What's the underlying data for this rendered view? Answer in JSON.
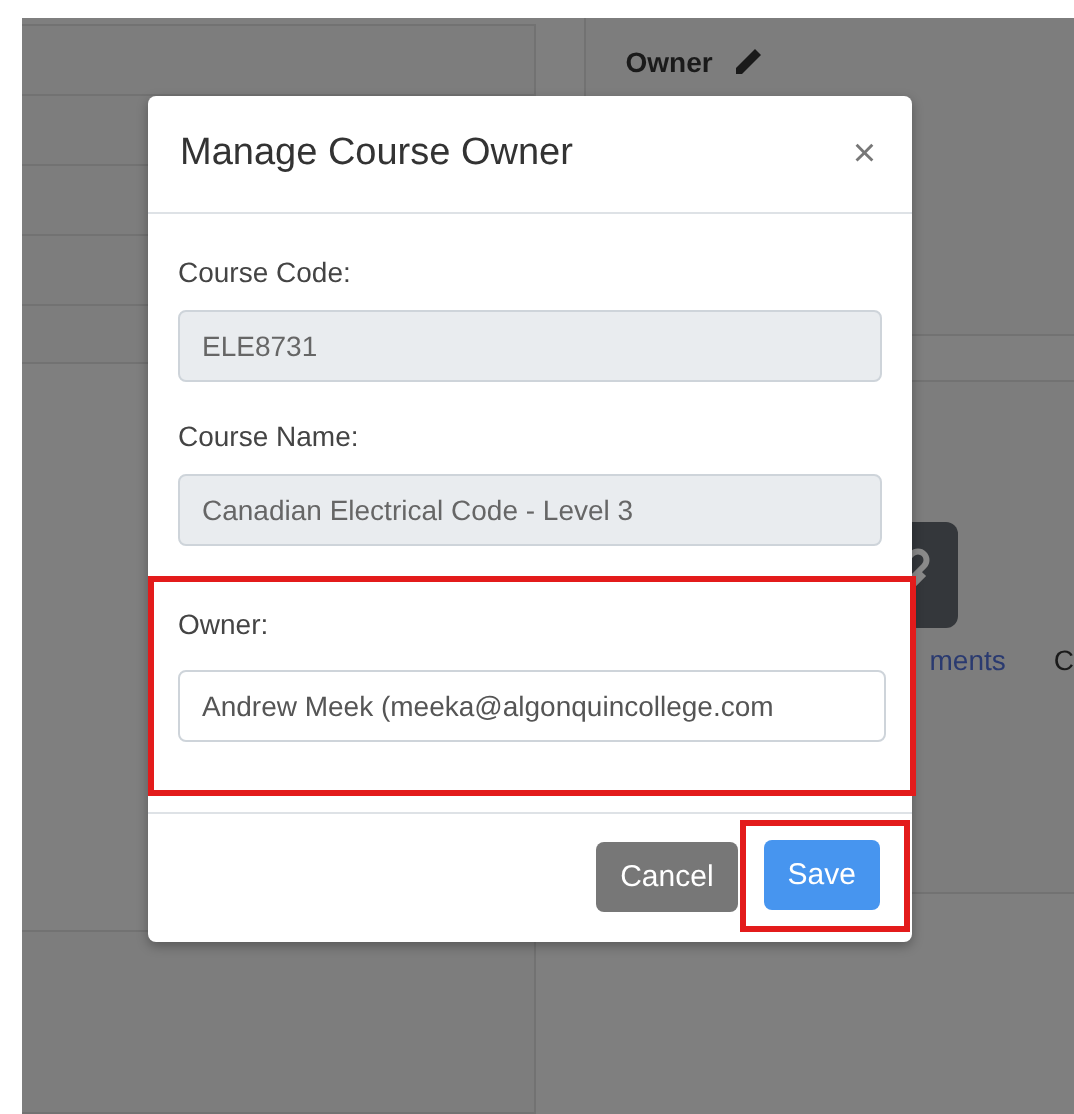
{
  "background": {
    "owner_heading": "Owner",
    "link_fragment": "ments",
    "cut_text": "C"
  },
  "modal": {
    "title": "Manage Course Owner",
    "close": "×",
    "fields": [
      {
        "label": "Course Code:",
        "value": "ELE8731",
        "disabled": true,
        "highlighted": false
      },
      {
        "label": "Course Name:",
        "value": "Canadian Electrical Code - Level 3",
        "disabled": true,
        "highlighted": false
      },
      {
        "label": "Owner:",
        "value": "Andrew Meek (meeka@algonquincollege.com",
        "disabled": false,
        "highlighted": true
      }
    ],
    "buttons": [
      {
        "label": "Cancel",
        "kind": "secondary",
        "highlighted": false
      },
      {
        "label": "Save",
        "kind": "primary",
        "highlighted": true
      }
    ]
  }
}
